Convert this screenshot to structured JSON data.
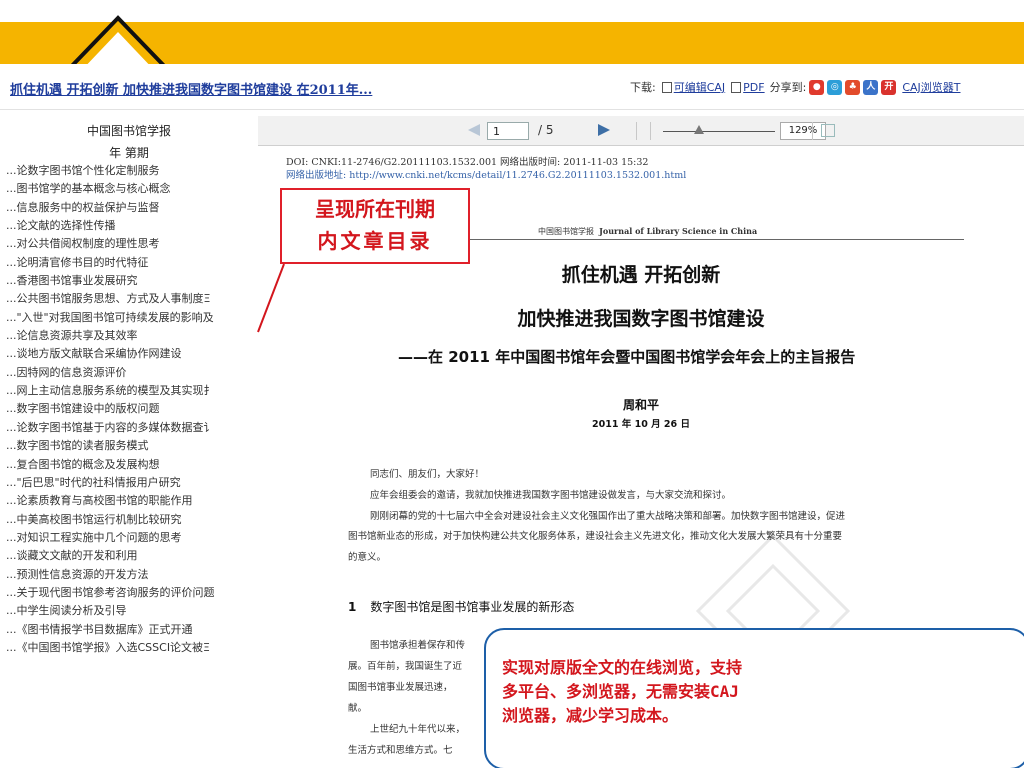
{
  "header": {
    "article_title": "抓住机遇 开拓创新 加快推进我国数字图书馆建设 在2011年...",
    "download_label": "下载:",
    "download_caj": "可编辑CAJ",
    "download_pdf": "PDF",
    "share_label": "分享到:",
    "caj_browser": "CAJ浏览器T"
  },
  "sidebar": {
    "journal_name": "中国图书馆学报",
    "issue_label": "年 第期",
    "articles": [
      "...论数字图书馆个性化定制服务",
      "...图书馆学的基本概念与核心概念",
      "...信息服务中的权益保护与监督",
      "...论文献的选择性传播",
      "...对公共借阅权制度的理性思考",
      "...论明清官修书目的时代特征",
      "...香港图书馆事业发展研究",
      "...公共图书馆服务思想、方式及人事制度Ξ",
      "...\"入世\"对我国图书馆可持续发展的影响及",
      "...论信息资源共享及其效率",
      "...谈地方版文献联合采编协作网建设",
      "...因特网的信息资源评价",
      "...网上主动信息服务系统的模型及其实现扌",
      "...数字图书馆建设中的版权问题",
      "...论数字图书馆基于内容的多媒体数据查讠",
      "...数字图书馆的读者服务模式",
      "...复合图书馆的概念及发展构想",
      "...\"后巴思\"时代的社科情报用户研究",
      "...论素质教育与高校图书馆的职能作用",
      "...中美高校图书馆运行机制比较研究",
      "...对知识工程实施中几个问题的思考",
      "...谈藏文文献的开发和利用",
      "...预测性信息资源的开发方法",
      "...关于现代图书馆参考咨询服务的评价问题",
      "...中学生阅读分析及引导",
      "...《图书情报学书目数据库》正式开通",
      "...《中国图书馆学报》入选CSSCI论文被Ξ"
    ]
  },
  "toolbar": {
    "page_current": "1",
    "page_total": "/ 5",
    "zoom": "129%"
  },
  "document": {
    "doi_line": "DOI: CNKI:11-2746/G2.20111103.1532.001   网络出版时间: 2011-11-03 15:32",
    "url_line": "网络出版地址: http://www.cnki.net/kcms/detail/11.2746.G2.20111103.1532.001.html",
    "running_head_cn": "中国图书馆学报",
    "running_head_en": "Journal of Library Science in China",
    "title_line1": "抓住机遇  开拓创新",
    "title_line2": "加快推进我国数字图书馆建设",
    "title_line3": "——在 2011 年中国图书馆年会暨中国图书馆学会年会上的主旨报告",
    "author": "周和平",
    "date": "2011 年 10 月 26 日",
    "para1": "同志们、朋友们，大家好！",
    "para2": "应年会组委会的邀请，我就加快推进我国数字图书馆建设做发言，与大家交流和探讨。",
    "para3a": "刚刚闭幕的党的十七届六中全会对建设社会主义文化强国作出了重大战略决策和部署。加快数字图书馆建设，促进",
    "para3b": "图书馆新业态的形成，对于加快构建公共文化服务体系，建设社会主义先进文化，推动文化大发展大繁荣具有十分重要",
    "para3c": "的意义。",
    "section_num": "1",
    "section_title": "数字图书馆是图书馆事业发展的新形态",
    "para4a": "图书馆承担着保存和传",
    "para4b": "展。百年前，我国诞生了近",
    "para4c": "国图书馆事业发展迅速，",
    "para4d": "献。",
    "para5a": "上世纪九十年代以来，",
    "para5b": "生活方式和思维方式。七"
  },
  "annotations": {
    "callout1_line1": "呈现所在刊期",
    "callout1_line2": "内文章目录",
    "callout2_line1": "实现对原版全文的在线浏览，支持",
    "callout2_line2": "多平台、多浏览器，无需安装CAJ",
    "callout2_line3": "浏览器，减少学习成本。"
  },
  "colors": {
    "banner_gold": "#f5b400",
    "link_blue": "#1f3d9c",
    "annotation_red": "#d3161d",
    "callout_blue_border": "#1d5fa8"
  }
}
